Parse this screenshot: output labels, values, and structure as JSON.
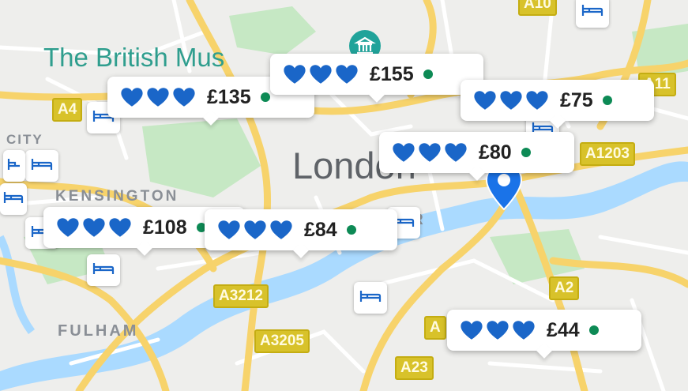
{
  "map": {
    "colors": {
      "land": "#eeeeec",
      "major_road": "#f7d36b",
      "minor_road": "#ffffff",
      "water": "#aadaff",
      "park": "#c6e8c4",
      "accent_blue": "#1a73e8",
      "dot_green": "#0d8a55"
    },
    "place_labels": {
      "british_museum": "The British Mus",
      "london": "London",
      "kensington": "KENSINGTON",
      "fulham": "FULHAM",
      "city": "CITY",
      "r_fragment": "R"
    },
    "road_shields": {
      "a10": "A10",
      "a4": "A4",
      "a11": "A11",
      "a1203": "A1203",
      "a3212": "A3212",
      "a3205": "A3205",
      "a2": "A2",
      "a23": "A23",
      "a_partial": "A"
    },
    "markers": [
      {
        "price": "£135",
        "hearts": 3,
        "available": true
      },
      {
        "price": "£155",
        "hearts": 3,
        "available": true
      },
      {
        "price": "£75",
        "hearts": 3,
        "available": true
      },
      {
        "price": "£80",
        "hearts": 3,
        "available": true
      },
      {
        "price": "£108",
        "hearts": 3,
        "available": true
      },
      {
        "price": "£84",
        "hearts": 3,
        "available": true
      },
      {
        "price": "£44",
        "hearts": 3,
        "available": true
      }
    ],
    "icons": {
      "hotel": "hotel-bed-icon",
      "heart": "heart-icon",
      "location_pin": "location-pin-icon",
      "attraction": "museum-pin-icon"
    }
  }
}
